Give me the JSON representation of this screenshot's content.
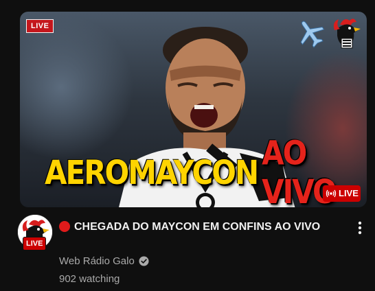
{
  "thumbnail": {
    "live_tag": "LIVE",
    "headline_part1": "AEROMAYCON",
    "headline_part2": "AO VIVO",
    "live_badge": "LIVE"
  },
  "video": {
    "title": "CHEGADA DO MAYCON EM CONFINS AO VIVO",
    "channel": "Web Rádio Galo",
    "viewers": "902 watching"
  },
  "avatar": {
    "live_label": "LIVE"
  },
  "icons": {
    "recording": "red-dot-icon",
    "verified": "verified-check-icon",
    "menu": "more-vert-icon",
    "plane": "airplane-icon",
    "live_broadcast": "broadcast-icon"
  },
  "colors": {
    "live_red": "#cc0000",
    "headline_yellow": "#ffd400",
    "headline_red": "#e5231b",
    "secondary_text": "#aaaaaa"
  }
}
